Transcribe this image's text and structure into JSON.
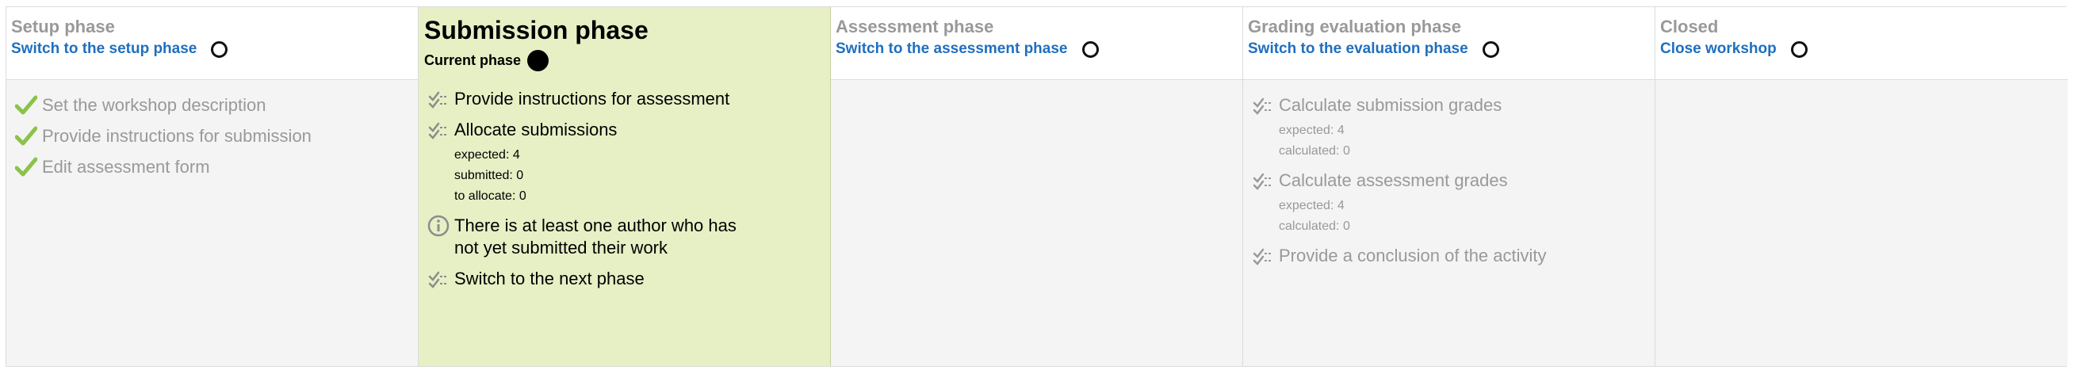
{
  "phases": {
    "setup": {
      "title": "Setup phase",
      "switch_label": "Switch to the setup phase",
      "tasks": [
        {
          "label": "Set the workshop description",
          "status": "done",
          "icon": "check-icon"
        },
        {
          "label": "Provide instructions for submission",
          "status": "done",
          "icon": "check-icon"
        },
        {
          "label": "Edit assessment form",
          "status": "done",
          "icon": "check-icon"
        }
      ]
    },
    "submission": {
      "title": "Submission phase",
      "current_label": "Current phase",
      "tasks": [
        {
          "label": "Provide instructions for assessment",
          "status": "todo",
          "icon": "todo-icon"
        },
        {
          "label": "Allocate submissions",
          "status": "todo",
          "icon": "todo-icon",
          "details": [
            "expected: 4",
            "submitted: 0",
            "to allocate: 0"
          ]
        },
        {
          "label": "There is at least one author who has not yet submitted their work",
          "status": "info",
          "icon": "info-icon"
        },
        {
          "label": "Switch to the next phase",
          "status": "todo",
          "icon": "todo-icon"
        }
      ]
    },
    "assessment": {
      "title": "Assessment phase",
      "switch_label": "Switch to the assessment phase"
    },
    "evaluation": {
      "title": "Grading evaluation phase",
      "switch_label": "Switch to the evaluation phase",
      "tasks": [
        {
          "label": "Calculate submission grades",
          "status": "todo",
          "icon": "todo-icon",
          "details": [
            "expected: 4",
            "calculated: 0"
          ]
        },
        {
          "label": "Calculate assessment grades",
          "status": "todo",
          "icon": "todo-icon",
          "details": [
            "expected: 4",
            "calculated: 0"
          ]
        },
        {
          "label": "Provide a conclusion of the activity",
          "status": "todo",
          "icon": "todo-icon"
        }
      ]
    },
    "closed": {
      "title": "Closed",
      "switch_label": "Close workshop"
    }
  },
  "colors": {
    "current_bg": "#e7efc5",
    "inactive_bg": "#f4f4f4",
    "link": "#1f6fbf",
    "check": "#8bc34a",
    "muted_text": "#999999"
  }
}
